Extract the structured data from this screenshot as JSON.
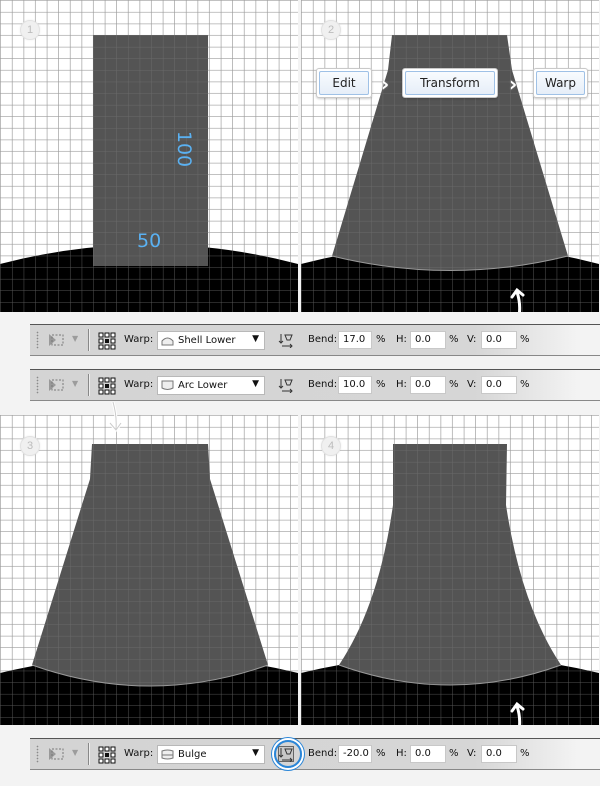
{
  "panels": [
    {
      "step": "1",
      "dim_height": "100",
      "dim_width": "50"
    },
    {
      "step": "2",
      "breadcrumb": [
        "Edit",
        "Transform",
        "Warp"
      ]
    },
    {
      "step": "3"
    },
    {
      "step": "4"
    }
  ],
  "toolbars": [
    {
      "warp_label": "Warp:",
      "warp_style": "Shell Lower",
      "bend_label": "Bend:",
      "bend": "17.0",
      "h_label": "H:",
      "h": "0.0",
      "v_label": "V:",
      "v": "0.0",
      "pct": "%"
    },
    {
      "warp_label": "Warp:",
      "warp_style": "Arc Lower",
      "bend_label": "Bend:",
      "bend": "10.0",
      "h_label": "H:",
      "h": "0.0",
      "v_label": "V:",
      "v": "0.0",
      "pct": "%"
    },
    {
      "warp_label": "Warp:",
      "warp_style": "Bulge",
      "bend_label": "Bend:",
      "bend": "-20.0",
      "h_label": "H:",
      "h": "0.0",
      "v_label": "V:",
      "v": "0.0",
      "pct": "%"
    }
  ],
  "icons": {
    "tool": "marquee-move-icon",
    "reference_grid": "reference-point-grid-icon",
    "warp_orientation": "change-warp-orientation-icon",
    "dropdown": "caret-down-icon"
  },
  "colors": {
    "shape_fill": "#545454",
    "ground": "#000000",
    "grid_line": "#9c9c9c",
    "dimension_text": "#5ab1f2",
    "highlight": "#2a86d8"
  }
}
